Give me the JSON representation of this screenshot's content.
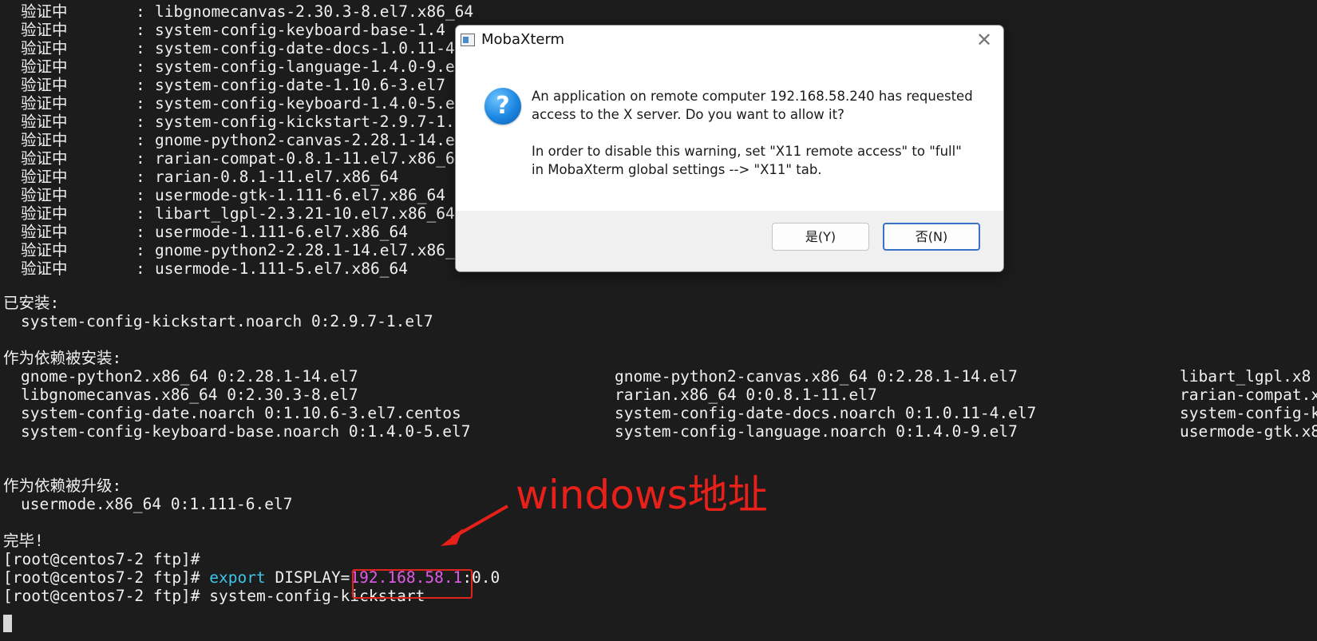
{
  "terminal": {
    "verify_lines": [
      {
        "label": "验证中",
        "sep": ":",
        "pkg": "libgnomecanvas-2.30.3-8.el7.x86_64"
      },
      {
        "label": "验证中",
        "sep": ":",
        "pkg": "system-config-keyboard-base-1.4"
      },
      {
        "label": "验证中",
        "sep": ":",
        "pkg": "system-config-date-docs-1.0.11-4"
      },
      {
        "label": "验证中",
        "sep": ":",
        "pkg": "system-config-language-1.4.0-9.e"
      },
      {
        "label": "验证中",
        "sep": ":",
        "pkg": "system-config-date-1.10.6-3.el7"
      },
      {
        "label": "验证中",
        "sep": ":",
        "pkg": "system-config-keyboard-1.4.0-5.e"
      },
      {
        "label": "验证中",
        "sep": ":",
        "pkg": "system-config-kickstart-2.9.7-1."
      },
      {
        "label": "验证中",
        "sep": ":",
        "pkg": "gnome-python2-canvas-2.28.1-14.e"
      },
      {
        "label": "验证中",
        "sep": ":",
        "pkg": "rarian-compat-0.8.1-11.el7.x86_6"
      },
      {
        "label": "验证中",
        "sep": ":",
        "pkg": "rarian-0.8.1-11.el7.x86_64"
      },
      {
        "label": "验证中",
        "sep": ":",
        "pkg": "usermode-gtk-1.111-6.el7.x86_64"
      },
      {
        "label": "验证中",
        "sep": ":",
        "pkg": "libart_lgpl-2.3.21-10.el7.x86_64"
      },
      {
        "label": "验证中",
        "sep": ":",
        "pkg": "usermode-1.111-6.el7.x86_64"
      },
      {
        "label": "验证中",
        "sep": ":",
        "pkg": "gnome-python2-2.28.1-14.el7.x86_"
      },
      {
        "label": "验证中",
        "sep": ":",
        "pkg": "usermode-1.111-5.el7.x86_64"
      }
    ],
    "installed_header": "已安装:",
    "installed_pkg": "system-config-kickstart.noarch 0:2.9.7-1.el7",
    "deps_header": "作为依赖被安装:",
    "deps_rows": [
      [
        "gnome-python2.x86_64 0:2.28.1-14.el7",
        "gnome-python2-canvas.x86_64 0:2.28.1-14.el7",
        "libart_lgpl.x8"
      ],
      [
        "libgnomecanvas.x86_64 0:2.30.3-8.el7",
        "rarian.x86_64 0:0.8.1-11.el7",
        "rarian-compat.x"
      ],
      [
        "system-config-date.noarch 0:1.10.6-3.el7.centos",
        "system-config-date-docs.noarch 0:1.0.11-4.el7",
        "system-config-k"
      ],
      [
        "system-config-keyboard-base.noarch 0:1.4.0-5.el7",
        "system-config-language.noarch 0:1.4.0-9.el7",
        "usermode-gtk.x8"
      ]
    ],
    "upgraded_header": "作为依赖被升级:",
    "upgraded_pkg": "usermode.x86_64 0:1.111-6.el7",
    "done": "完毕!",
    "prompt": "[root@centos7-2 ftp]#",
    "cmd_export_kw": "export",
    "cmd_export_var": "DISPLAY=",
    "cmd_export_ip": "192.168.58.1",
    "cmd_export_rest": ":0.0",
    "cmd_last": "system-config-kickstart"
  },
  "annotation": {
    "text": "windows地址",
    "color": "#e8201a"
  },
  "dialog": {
    "title": "MobaXterm",
    "icon": "question-icon",
    "message_line1": "An application on remote computer 192.168.58.240 has requested",
    "message_line2": "access to the X server. Do you want to allow it?",
    "message_line3": "In order to disable this warning, set \"X11 remote access\" to \"full\"",
    "message_line4": "in MobaXterm global settings --> \"X11\" tab.",
    "yes_label": "是(Y)",
    "no_label": "否(N)"
  },
  "colors": {
    "terminal_bg": "#1c1c1c",
    "keyword": "#3fc4ea",
    "ip": "#e05ce8"
  }
}
